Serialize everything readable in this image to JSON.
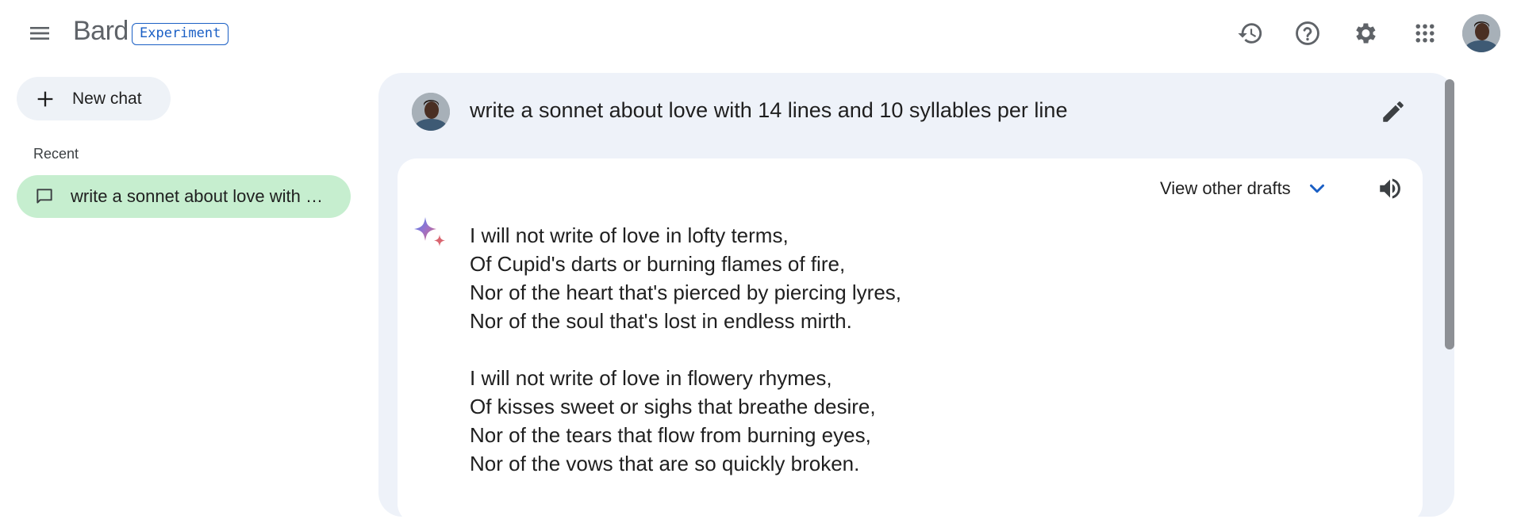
{
  "app": {
    "name": "Bard",
    "badge": "Experiment"
  },
  "header": {
    "icons": [
      "menu-icon",
      "history-icon",
      "help-icon",
      "settings-icon",
      "apps-grid-icon",
      "avatar"
    ]
  },
  "sidebar": {
    "new_chat_label": "New chat",
    "recent_heading": "Recent",
    "recent_items": [
      {
        "label": "write a sonnet about love with 14 lines and 10 syllables per line",
        "icon": "chat-bubble-icon"
      }
    ]
  },
  "conversation": {
    "prompt": "write a sonnet about love with 14 lines and 10 syllables per line",
    "response": {
      "drafts_label": "View other drafts",
      "stanzas": [
        [
          "I will not write of love in lofty terms,",
          "Of Cupid's darts or burning flames of fire,",
          "Nor of the heart that's pierced by piercing lyres,",
          "Nor of the soul that's lost in endless mirth."
        ],
        [
          "I will not write of love in flowery rhymes,",
          "Of kisses sweet or sighs that breathe desire,",
          "Nor of the tears that flow from burning eyes,",
          "Nor of the vows that are so quickly broken."
        ]
      ]
    }
  },
  "colors": {
    "accent_blue": "#1a5fc5",
    "recent_item_bg": "#c6eecf",
    "new_chat_bg": "#eef2f7",
    "panel_bg": "#eef2f9",
    "icon_gray": "#5f6368"
  }
}
